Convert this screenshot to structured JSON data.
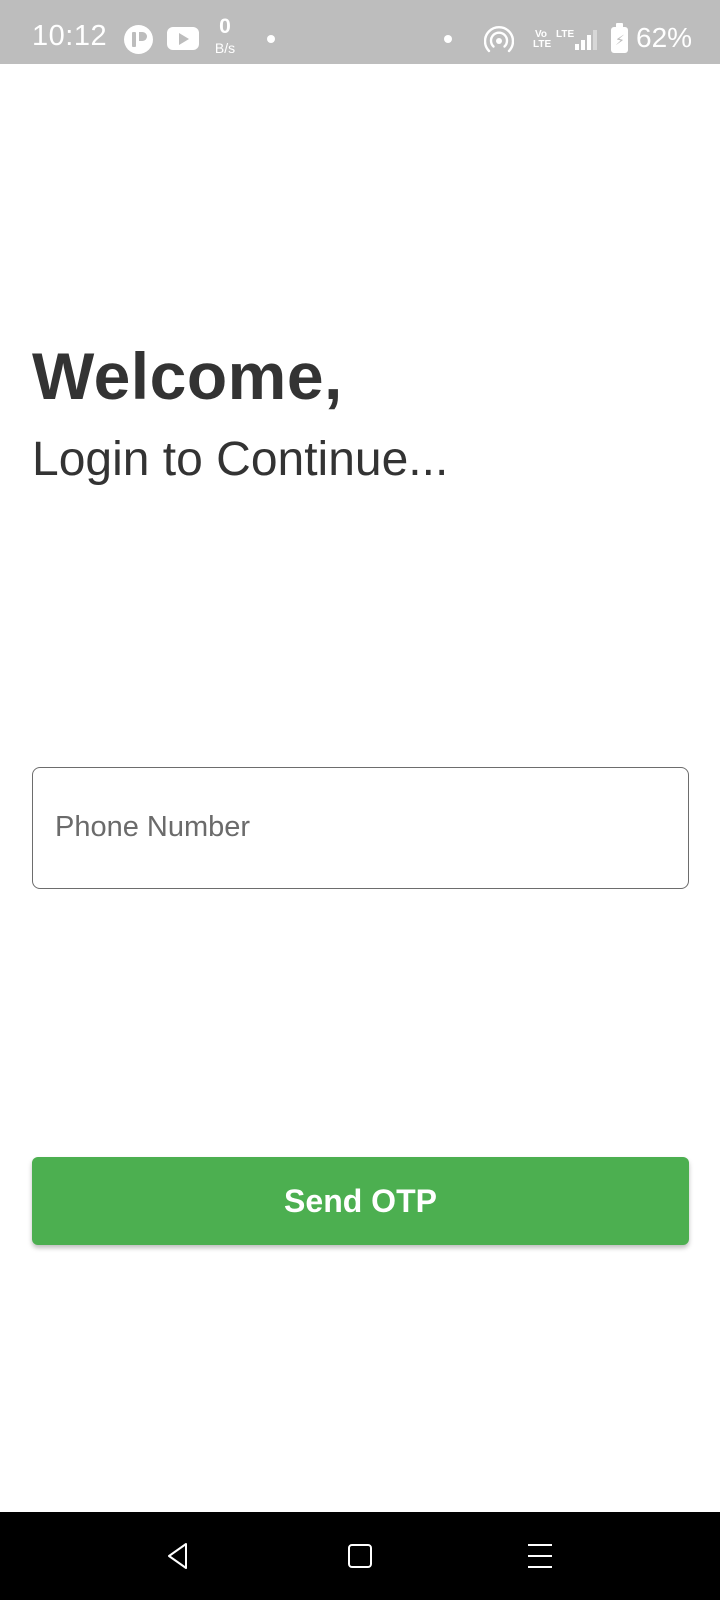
{
  "status_bar": {
    "time": "10:12",
    "net_speed_value": "0",
    "net_speed_unit": "B/s",
    "volte": "Vo LTE",
    "lte": "LTE",
    "battery_percent": "62%",
    "icons": [
      "app-t-icon",
      "youtube-icon",
      "hotspot-icon",
      "volte-icon",
      "lte-icon",
      "signal-icon",
      "battery-charging-icon"
    ]
  },
  "login": {
    "title": "Welcome,",
    "subtitle": "Login to Continue...",
    "phone_placeholder": "Phone Number",
    "phone_value": "",
    "send_button": "Send OTP"
  },
  "nav_bar": {
    "buttons": [
      "back-icon",
      "home-icon",
      "menu-icon"
    ]
  },
  "colors": {
    "status_bar_bg": "#bdbdbd",
    "accent": "#4caf50",
    "text": "#333333",
    "nav_bar_bg": "#000000"
  }
}
